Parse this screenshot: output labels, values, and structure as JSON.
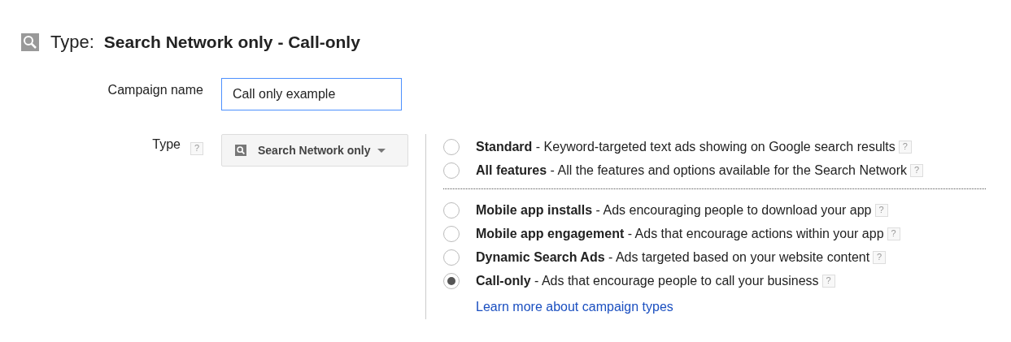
{
  "header": {
    "label": "Type:",
    "value": "Search Network only - Call-only"
  },
  "campaign_name": {
    "label": "Campaign name",
    "value": "Call only example"
  },
  "type_field": {
    "label": "Type",
    "help": "?",
    "dropdown": "Search Network only"
  },
  "option_groups": [
    {
      "options": [
        {
          "text": "**Standard** - Keyword-targeted text ads showing on Google search results",
          "help": "?",
          "selected": false
        },
        {
          "text": "**All features** - All the features and options available for the Search Network",
          "help": "?",
          "selected": false
        }
      ]
    },
    {
      "options": [
        {
          "text": "**Mobile app installs** - Ads encouraging people to download your app",
          "help": "?",
          "selected": false
        },
        {
          "text": "**Mobile app engagement** - Ads that encourage actions within your app",
          "help": "?",
          "selected": false
        },
        {
          "text": "**Dynamic Search Ads** - Ads targeted based on your website content",
          "help": "?",
          "selected": false
        },
        {
          "text": "**Call-only** - Ads that encourage people to call your business",
          "help": "?",
          "selected": true
        }
      ]
    }
  ],
  "learn_more": "Learn more about campaign types"
}
